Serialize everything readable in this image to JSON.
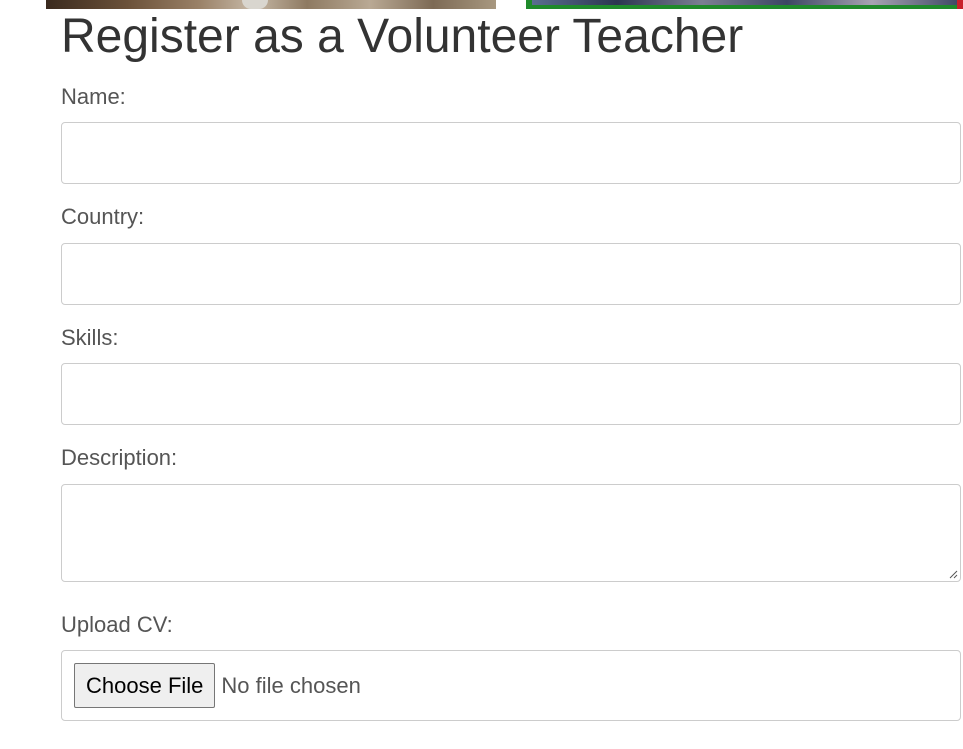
{
  "header": {
    "title": "Register as a Volunteer Teacher"
  },
  "form": {
    "name_label": "Name:",
    "country_label": "Country:",
    "skills_label": "Skills:",
    "description_label": "Description:",
    "cv_label": "Upload CV:",
    "file_button_label": "Choose File",
    "file_status": "No file chosen"
  },
  "colors": {
    "text": "#333333",
    "label": "#555555",
    "border": "#cccccc",
    "banner_green": "#1f8a2b"
  }
}
